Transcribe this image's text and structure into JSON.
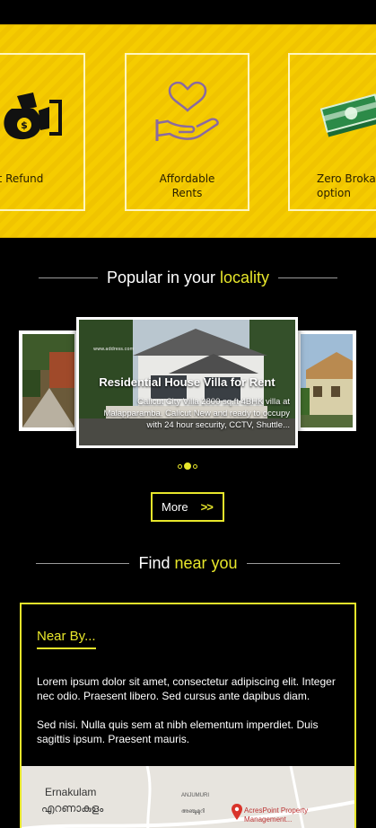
{
  "features": [
    {
      "label": "ant Refund",
      "icon": "money-bag-icon"
    },
    {
      "label": "Affordable\nRents",
      "icon": "heart-hand-icon"
    },
    {
      "label": "Zero Broka\noption",
      "icon": "cash-stack-icon"
    }
  ],
  "popular": {
    "prefix": "Popular in your",
    "highlight": "locality"
  },
  "carousel": {
    "title": "Residential House Villa for Rent",
    "description": "Calicut City Villa 2800 sq.ft 4BHK villa at Malapparamba. Calicut New and ready to occupy with 24 hour security, CCTV, Shuttle...",
    "slide_count": 3,
    "active_slide": 2
  },
  "more_button": {
    "label": "More",
    "arrows": ">>"
  },
  "find": {
    "prefix": "Find",
    "highlight": "near you"
  },
  "nearby": {
    "title": "Near By...",
    "para1": "Lorem ipsum dolor sit amet, consectetur adipiscing elit. Integer nec odio. Praesent libero. Sed cursus ante dapibus diam.",
    "para2": "Sed nisi. Nulla quis sem at nibh elementum imperdiet. Duis sagittis ipsum. Praesent mauris."
  },
  "map": {
    "city": "Ernakulam",
    "city_local": "എറണാകുളം",
    "area": "ANJUMURI",
    "area_local": "അഞ്ചുമുറി",
    "place": "AcresPoint Property\nManagement..."
  },
  "colors": {
    "accent": "#e7e62b",
    "band": "#f5cc00",
    "background": "#000000"
  }
}
